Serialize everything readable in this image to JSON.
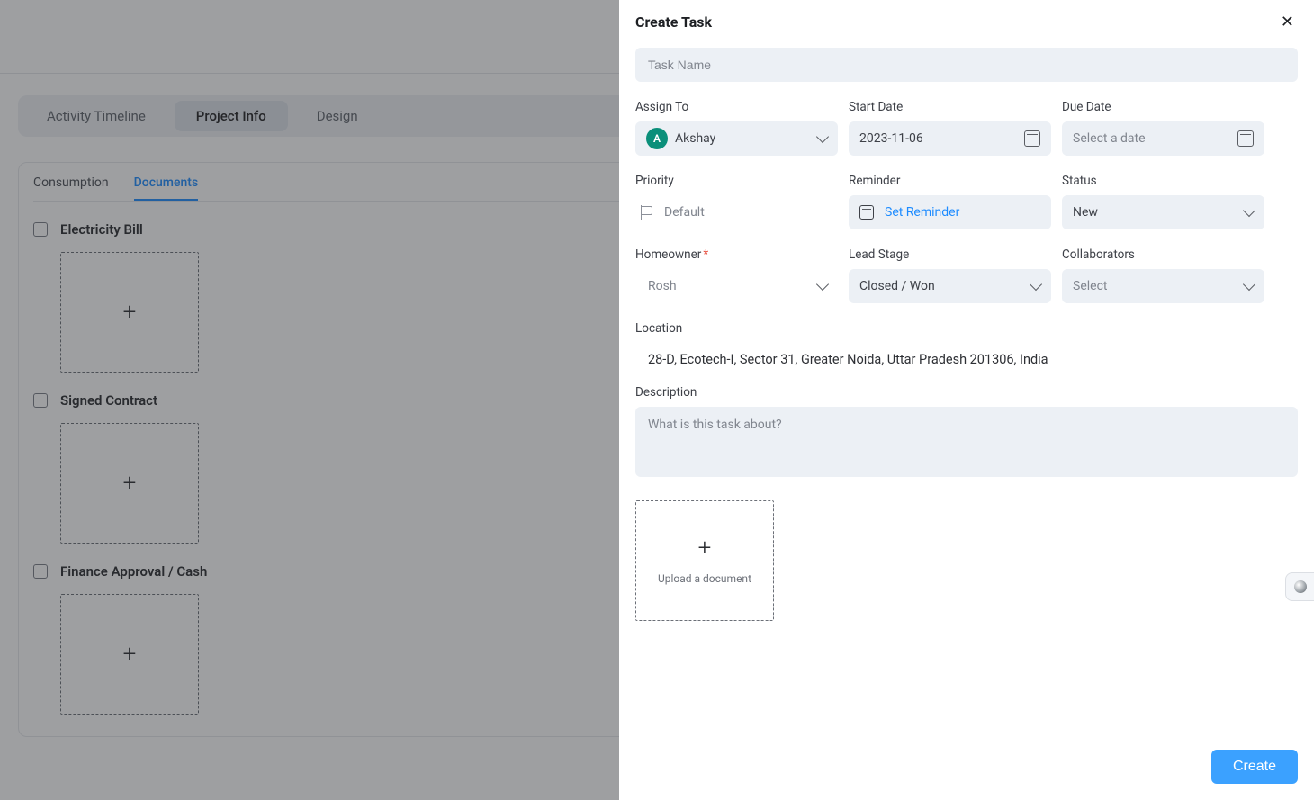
{
  "background": {
    "tabs": [
      "Activity Timeline",
      "Project Info",
      "Design"
    ],
    "active_tab_index": 1,
    "subtabs": [
      "Consumption",
      "Documents"
    ],
    "active_subtab_index": 1,
    "documents": [
      {
        "title": "Electricity Bill"
      },
      {
        "title": "Signed Contract"
      },
      {
        "title": "Finance Approval / Cash"
      }
    ]
  },
  "panel": {
    "title": "Create Task",
    "task_name_placeholder": "Task Name",
    "labels": {
      "assign_to": "Assign To",
      "start_date": "Start Date",
      "due_date": "Due Date",
      "priority": "Priority",
      "reminder": "Reminder",
      "status": "Status",
      "homeowner": "Homeowner",
      "lead_stage": "Lead Stage",
      "collaborators": "Collaborators",
      "location": "Location",
      "description": "Description"
    },
    "assign_to": {
      "avatar_initial": "A",
      "name": "Akshay"
    },
    "start_date": "2023-11-06",
    "due_date_placeholder": "Select a date",
    "priority": "Default",
    "reminder_link": "Set Reminder",
    "status": "New",
    "homeowner_placeholder": "Rosh",
    "lead_stage": "Closed / Won",
    "collaborators_placeholder": "Select",
    "location_value": "28-D, Ecotech-I, Sector 31, Greater Noida, Uttar Pradesh 201306, India",
    "description_placeholder": "What is this task about?",
    "upload_label": "Upload a document",
    "create_button": "Create"
  }
}
